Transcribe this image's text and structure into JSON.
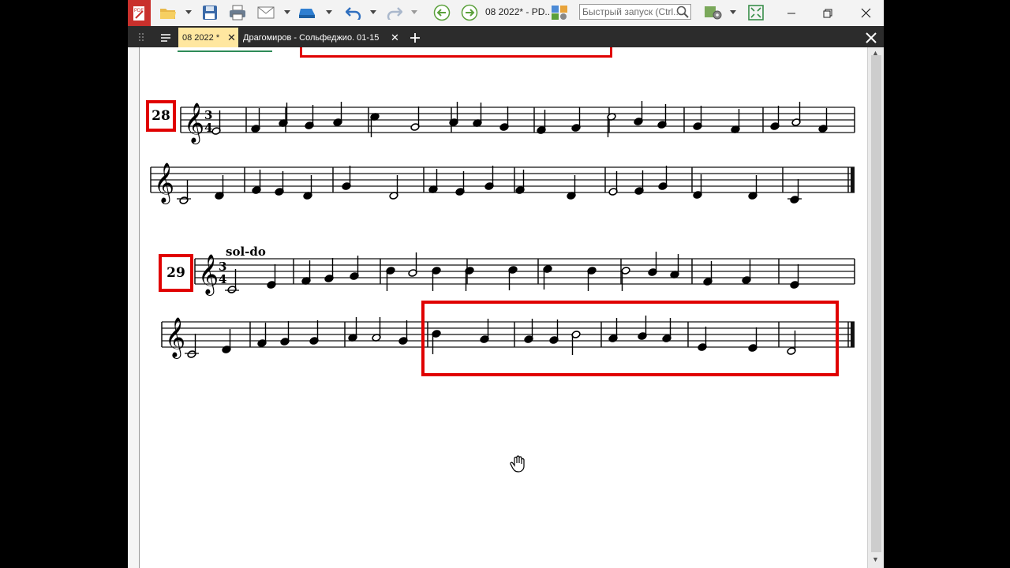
{
  "toolbar": {
    "window_title": "08 2022* - PD..",
    "quick_launch_placeholder": "Быстрый запуск (Ctrl..."
  },
  "tabs": [
    {
      "label": "08 2022 *",
      "active": true
    },
    {
      "label": "Драгомиров - Сольфеджио. 01-15",
      "active": false
    }
  ],
  "score": {
    "exercise_a": {
      "number": "28"
    },
    "exercise_b": {
      "number": "29",
      "label": "sol-do"
    }
  },
  "colors": {
    "highlight": "#e00000",
    "active_tab": "#ffe7a0",
    "tab_bar": "#2c2c2c"
  }
}
